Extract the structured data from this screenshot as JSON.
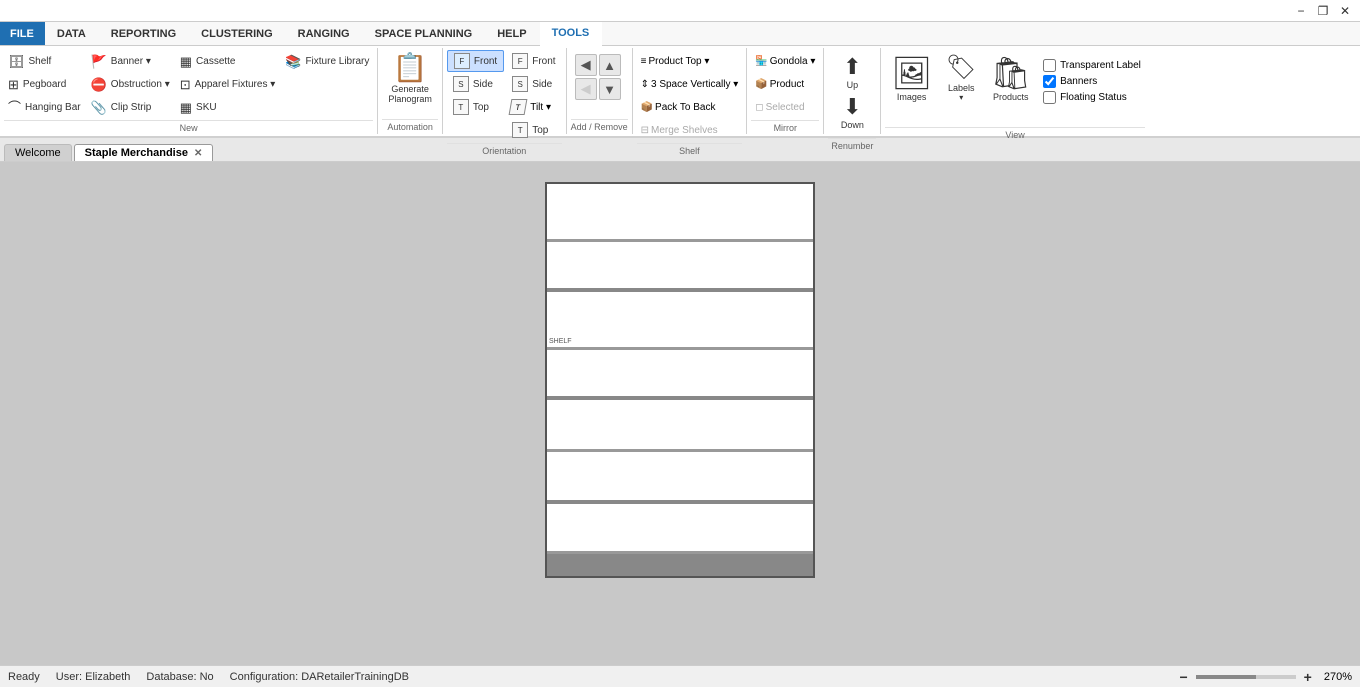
{
  "titleBar": {
    "minimize": "−",
    "restore": "❐",
    "close": "✕"
  },
  "ribbonTabs": [
    {
      "id": "file",
      "label": "FILE",
      "isFile": true
    },
    {
      "id": "data",
      "label": "DATA"
    },
    {
      "id": "reporting",
      "label": "REPORTING"
    },
    {
      "id": "clustering",
      "label": "CLUSTERING"
    },
    {
      "id": "ranging",
      "label": "RANGING"
    },
    {
      "id": "spacePlanning",
      "label": "SPACE PLANNING"
    },
    {
      "id": "help",
      "label": "HELP"
    },
    {
      "id": "tools",
      "label": "TOOLS",
      "active": true
    }
  ],
  "groups": {
    "new": {
      "label": "New",
      "items": [
        {
          "id": "shelf",
          "icon": "📦",
          "label": "Shelf"
        },
        {
          "id": "pegboard",
          "icon": "⊞",
          "label": "Pegboard"
        },
        {
          "id": "hangingBar",
          "icon": "⌒",
          "label": "Hanging Bar"
        },
        {
          "id": "banner",
          "icon": "🚩",
          "label": "Banner ▾"
        },
        {
          "id": "obstruction",
          "icon": "⛔",
          "label": "Obstruction ▾"
        },
        {
          "id": "clipStrip",
          "icon": "📎",
          "label": "Clip Strip"
        },
        {
          "id": "cassette",
          "icon": "▦",
          "label": "Cassette"
        },
        {
          "id": "applianceFixtures",
          "icon": "⊡",
          "label": "Apparel Fixtures ▾"
        },
        {
          "id": "fixtureLibrary",
          "icon": "📚",
          "label": "Fixture Library"
        },
        {
          "id": "sku",
          "icon": "▦",
          "label": "SKU"
        }
      ]
    },
    "automation": {
      "label": "Automation",
      "generatePlanogram": "Generate\nPlanogram"
    },
    "orientation": {
      "label": "Orientation",
      "front": {
        "label": "Front",
        "active": true
      },
      "side": {
        "label": "Side"
      },
      "top": {
        "label": "Top"
      },
      "front2": {
        "label": "Front"
      },
      "side2": {
        "label": "Side"
      },
      "tilt": {
        "label": "Tilt ▾"
      },
      "top2": {
        "label": "Top"
      }
    },
    "addRemove": {
      "label": "Add / Remove"
    },
    "shelf": {
      "label": "Shelf",
      "productTop": "Product Top ▾",
      "spaceVertically": "3  Space Vertically ▾",
      "packToBack": "Pack To Back",
      "mergeShelves": "Merge Shelves"
    },
    "mirror": {
      "label": "Mirror",
      "gondola": "Gondola ▾",
      "product": "Product",
      "selected": "Selected"
    },
    "renumber": {
      "label": "Renumber",
      "up": "Up",
      "down": "Down"
    },
    "view": {
      "label": "View",
      "images": "Images",
      "labels": "Labels",
      "products": "Products",
      "transparentLabel": "Transparent Label",
      "banners": "Banners",
      "floatingStatus": "Floating Status",
      "bannersChecked": true,
      "transparentChecked": false,
      "floatingChecked": false
    }
  },
  "tabs": [
    {
      "id": "welcome",
      "label": "Welcome",
      "active": false,
      "closeable": false
    },
    {
      "id": "staplerMerchandise",
      "label": "Staple Merchandise",
      "active": true,
      "closeable": true
    }
  ],
  "planogram": {
    "shelves": 8,
    "shelfLabel": "SHELF"
  },
  "statusBar": {
    "ready": "Ready",
    "user": "User: Elizabeth",
    "database": "Database: No",
    "configuration": "Configuration: DARetailerTrainingDB",
    "zoomPercent": "270%",
    "zoomMinus": "−",
    "zoomPlus": "+"
  }
}
